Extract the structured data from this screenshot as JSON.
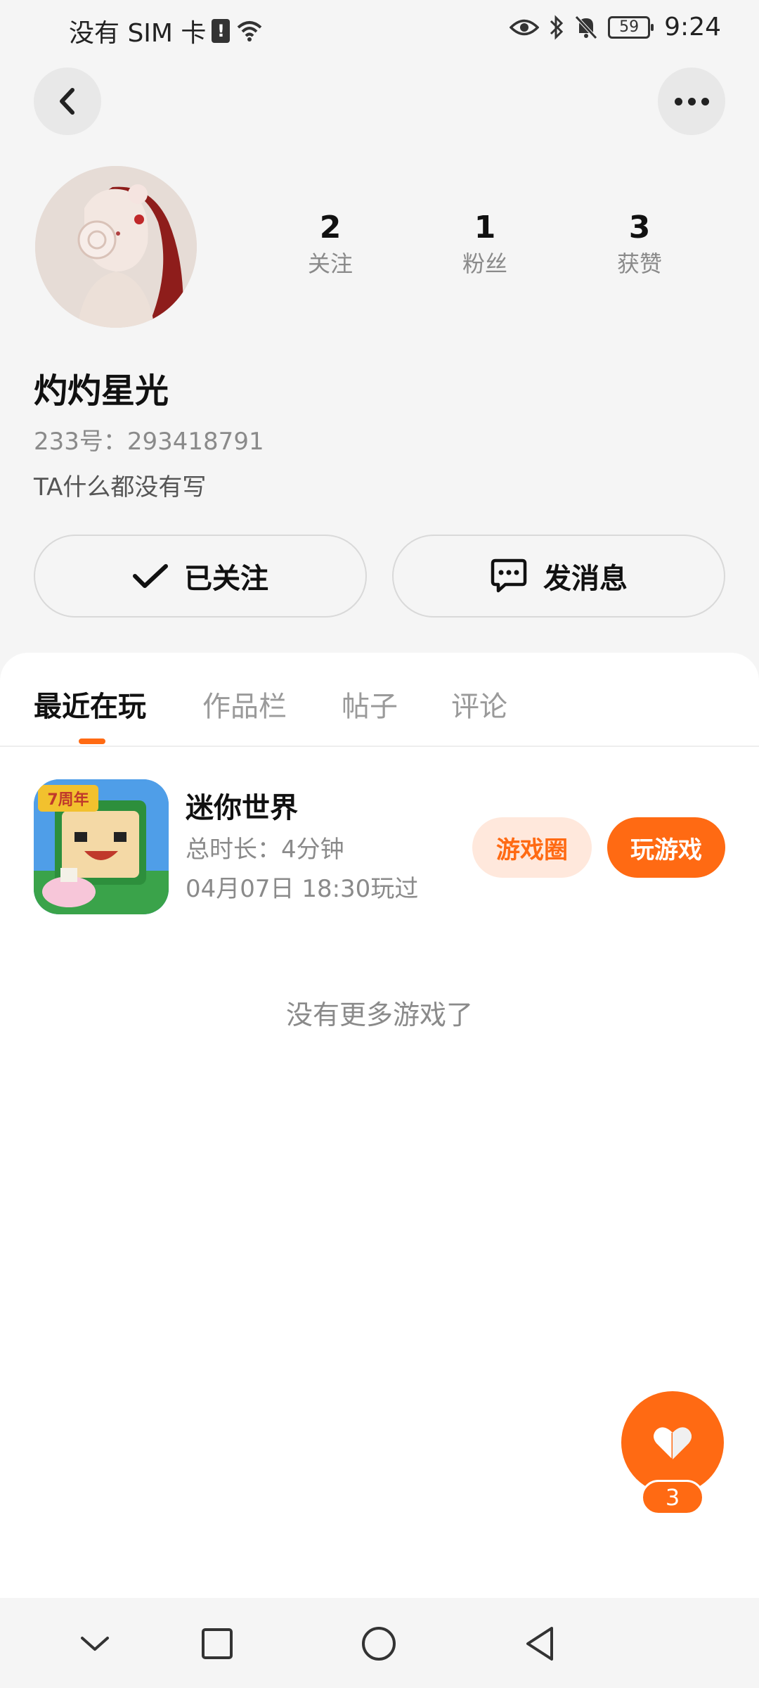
{
  "status_bar": {
    "carrier": "没有 SIM 卡",
    "sim_alert": "!",
    "battery": "59",
    "time": "9:24",
    "icons": [
      "wifi-icon",
      "eye-icon",
      "bluetooth-icon",
      "bell-off-icon",
      "battery-icon"
    ]
  },
  "nav": {
    "back_icon": "chevron-left-icon",
    "more_icon": "more-dots-icon"
  },
  "profile": {
    "nickname": "灼灼星光",
    "uid": "233号：293418791",
    "bio": "TA什么都没有写",
    "stats": [
      {
        "value": "2",
        "label": "关注"
      },
      {
        "value": "1",
        "label": "粉丝"
      },
      {
        "value": "3",
        "label": "获赞"
      }
    ]
  },
  "actions": {
    "follow_label": "已关注",
    "message_label": "发消息"
  },
  "tabs": [
    {
      "label": "最近在玩",
      "active": true
    },
    {
      "label": "作品栏",
      "active": false
    },
    {
      "label": "帖子",
      "active": false
    },
    {
      "label": "评论",
      "active": false
    }
  ],
  "games": [
    {
      "name": "迷你世界",
      "play_time": "总时长：4分钟",
      "last_played": "04月07日 18:30玩过",
      "circle_label": "游戏圈",
      "play_label": "玩游戏",
      "icon_badge": "7周年"
    }
  ],
  "empty_text": "没有更多游戏了",
  "like": {
    "count": "3",
    "icon": "heart-icon"
  },
  "system_nav": [
    "chevron-down-icon",
    "square-icon",
    "circle-icon",
    "triangle-back-icon"
  ],
  "colors": {
    "accent": "#ff6a13",
    "accent_light": "#ffe8dc",
    "background": "#f5f5f5",
    "text_secondary": "#8a8a8a"
  }
}
